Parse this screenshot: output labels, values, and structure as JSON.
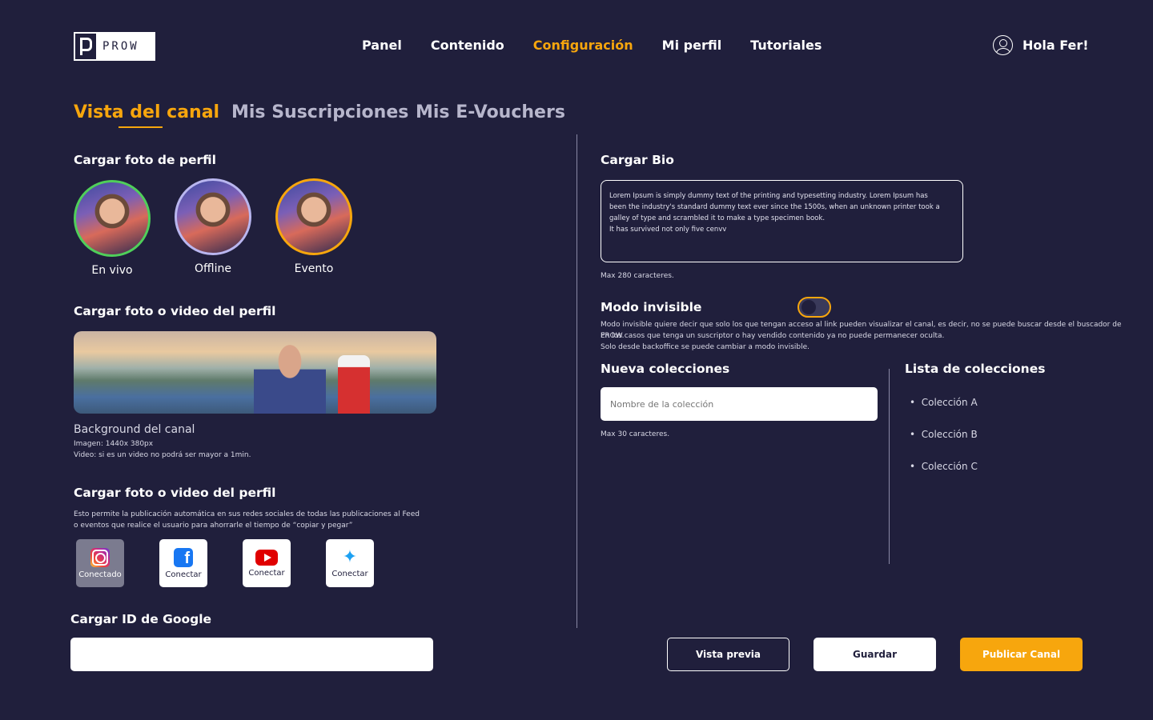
{
  "header": {
    "logo_text": "PROW",
    "nav": [
      "Panel",
      "Contenido",
      "Configuración",
      "Mi perfil",
      "Tutoriales"
    ],
    "active_nav": "Configuración",
    "greeting": "Hola Fer!"
  },
  "tabs": [
    "Vista del canal",
    "Mis Suscripciones",
    "Mis E-Vouchers"
  ],
  "profile_photo": {
    "title": "Cargar foto de perfil",
    "avatars": [
      {
        "label": "En vivo",
        "border_color": "#4fcf5a"
      },
      {
        "label": "Offline",
        "border_color": "#b9b6ef"
      },
      {
        "label": "Evento",
        "border_color": "#f7a60d"
      }
    ]
  },
  "background": {
    "title": "Cargar foto o video del perfil",
    "caption": "Background  del canal",
    "spec_image": "Imagen: 1440x 380px",
    "spec_video": "Video: si es un video no podrá ser mayor a 1min."
  },
  "social": {
    "title": "Cargar foto o video del perfil",
    "description_1": "Esto permite  la publicación automática en sus redes sociales de todas las publicaciones al Feed",
    "description_2": "o eventos que realice el usuario para ahorrarle el tiempo de “copiar y pegar”",
    "items": [
      {
        "icon": "instagram-icon",
        "label": "Conectado"
      },
      {
        "icon": "facebook-icon",
        "label": "Conectar"
      },
      {
        "icon": "youtube-icon",
        "label": "Conectar"
      },
      {
        "icon": "twitter-icon",
        "label": "Conectar"
      }
    ]
  },
  "google": {
    "title": "Cargar ID de Google",
    "value": ""
  },
  "bio": {
    "title": "Cargar Bio",
    "line_1": "Lorem Ipsum is simply dummy text of the printing and typesetting industry. Lorem Ipsum has",
    "line_2": "been the industry's standard dummy text ever since the 1500s, when an unknown printer took a",
    "line_3": "galley of type and scrambled it to make a type specimen book.",
    "line_4": "It has survived not only five cenvv",
    "max": "Max 280 caracteres."
  },
  "invisible": {
    "title": "Modo invisible",
    "enabled": false,
    "desc_1": "Modo invisible quiere decir que solo los que tengan acceso al link pueden visualizar el canal, es decir, no se puede buscar desde el buscador de PROW.",
    "desc_2": "En los casos que tenga un suscriptor o hay vendido contenido ya no puede permanecer oculta.",
    "desc_3": "Solo desde backoffice se puede cambiar a modo invisible."
  },
  "new_collection": {
    "title": "Nueva colecciones",
    "placeholder": "Nombre de la colección",
    "max": "Max 30 caracteres."
  },
  "collections": {
    "title": "Lista de colecciones",
    "items": [
      "Colección A",
      "Colección B",
      "Colección C"
    ]
  },
  "actions": {
    "preview": "Vista previa",
    "save": "Guardar",
    "publish": "Publicar Canal"
  }
}
